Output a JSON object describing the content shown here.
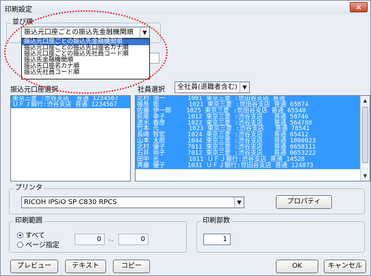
{
  "window": {
    "title": "印刷設定",
    "close_label": "×"
  },
  "sort_order": {
    "label": "並び順",
    "selected": "振込元口座ごとの振込先金融機関順",
    "options": [
      "振込元口座ごとの振込先金融機関順",
      "振込元口座ごとの振込先口座名カナ順",
      "振込元口座ごとの振込先社員コード順",
      "振込先金融機関順",
      "振込先口座名カナ順",
      "振込先社員コード順"
    ]
  },
  "source_account": {
    "label": "振込元口座選択",
    "rows": [
      "東京三菱 :渋谷支店  普通 1234567",
      "ＵＦＪ銀行:渋谷支店 普通 1234567"
    ]
  },
  "employee": {
    "label": "社員選択",
    "filter_value": "全社員(退職者含む)",
    "rows": [
      "北村 浩一      1001 東京三菱 :世田谷支店 普通",
      "福島 衛        1021 東京三菱 :世田谷支店 普通 65874",
      "佐藤 伊一郎    1025 東京三菱 :世田谷支店 普通 65540",
      "萩尾 幸子      1012 東京三菱 :渋谷支店   普通 58746",
      "清水 春彦      1022 東京三菱 :渋谷支店   普通 564788",
      "竹本 元        1023 東京三菱 :渋谷支店   普通 78541",
      "長崎 智宏      1024 東京三菱 :渋谷支店   普通 65412",
      "山本 太郎      1044 東京三菱 :渋谷支店   普通 1000023",
      "北村 優子      7011 東京三菱 :渋谷支店   普通 0658111",
      "石井 尚子      7012 東京三菱 :渋谷支店   普通 0653222",
      "田中 光        1011 ＵＦＪ銀行:渋谷支店 普通 14528",
      "斉藤 優子      1031 ＵＦＪ銀行:世田谷支店 普通 124873"
    ]
  },
  "printer": {
    "label": "プリンタ",
    "selected": "RICOH IPSiO SP C830 RPCS",
    "properties_label": "プロパティ"
  },
  "print_range": {
    "label": "印刷範囲",
    "all_label": "すべて",
    "pages_label": "ページ指定",
    "from": "0",
    "separator": "〜",
    "to": "0"
  },
  "copies": {
    "label": "印刷部数",
    "value": "1"
  },
  "buttons": {
    "preview": "プレビュー",
    "text": "テキスト",
    "copy": "コピー",
    "ok": "OK",
    "cancel": "キャンセル"
  },
  "colors": {
    "selection": "#3399ff",
    "highlight_ring": "#e81a1a",
    "close_button": "#c9462e"
  }
}
